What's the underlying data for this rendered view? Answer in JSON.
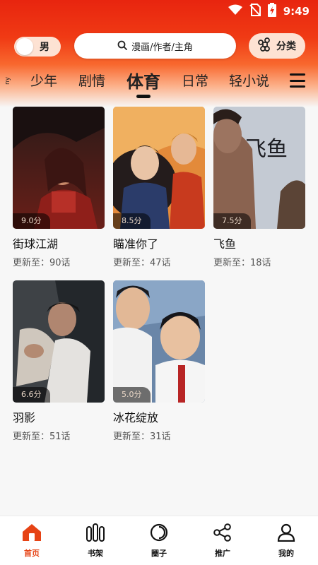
{
  "status_bar": {
    "time": "9:49",
    "icons": [
      "wifi-icon",
      "no-sim-icon",
      "battery-icon"
    ]
  },
  "top_bar": {
    "gender_label": "男",
    "search_placeholder": "漫画/作者/主角",
    "category_label": "分类"
  },
  "tabs": {
    "edge_text": "ny",
    "items": [
      {
        "label": "少年",
        "active": false
      },
      {
        "label": "剧情",
        "active": false
      },
      {
        "label": "体育",
        "active": true
      },
      {
        "label": "日常",
        "active": false
      },
      {
        "label": "轻小说",
        "active": false
      }
    ]
  },
  "comics": [
    {
      "title": "街球江湖",
      "update": "更新至：90话",
      "score": "9.0分"
    },
    {
      "title": "瞄准你了",
      "update": "更新至：47话",
      "score": "8.5分"
    },
    {
      "title": "飞鱼",
      "update": "更新至：18话",
      "score": "7.5分",
      "cover_text": "飞鱼"
    },
    {
      "title": "羽影",
      "update": "更新至：51话",
      "score": "6.6分"
    },
    {
      "title": "冰花绽放",
      "update": "更新至：31话",
      "score": "5.0分"
    }
  ],
  "bottom_nav": [
    {
      "label": "首页",
      "icon": "home-icon",
      "active": true
    },
    {
      "label": "书架",
      "icon": "bookshelf-icon",
      "active": false
    },
    {
      "label": "圈子",
      "icon": "circle-icon",
      "active": false
    },
    {
      "label": "推广",
      "icon": "share-icon",
      "active": false
    },
    {
      "label": "我的",
      "icon": "user-icon",
      "active": false
    }
  ],
  "colors": {
    "brand": "#e8250f",
    "active_nav": "#e64315"
  }
}
